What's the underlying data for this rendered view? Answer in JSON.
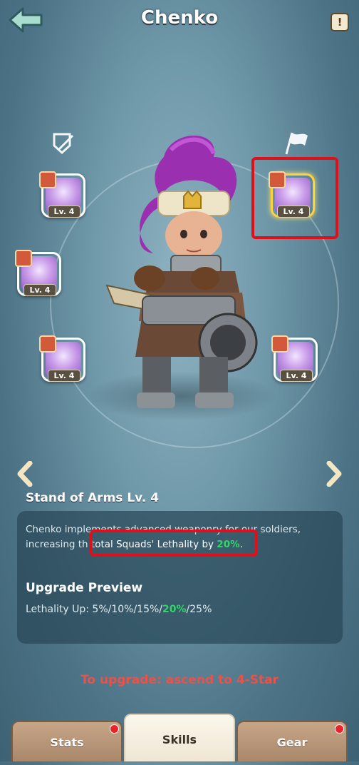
{
  "header": {
    "title": "Chenko",
    "info_label": "!"
  },
  "skills": [
    {
      "level": "Lv. 4"
    },
    {
      "level": "Lv. 4"
    },
    {
      "level": "Lv. 4"
    },
    {
      "level": "Lv. 4"
    },
    {
      "level": "Lv. 4"
    }
  ],
  "detail": {
    "skill_name": "Stand of Arms Lv. 4",
    "desc_part1": "Chenko implements advanced weaponry for our soldiers,",
    "desc_part2": "increasing th",
    "desc_hl": "total Squads' Lethality by ",
    "desc_value": "20%",
    "desc_end": ".",
    "upgrade_title": "Upgrade Preview",
    "upgrade_prefix": "Lethality Up: 5%/10%/15%/",
    "upgrade_current": "20%",
    "upgrade_suffix": "/25%",
    "requirement": "To upgrade: ascend to 4-Star"
  },
  "tabs": [
    {
      "label": "Stats",
      "badge": true
    },
    {
      "label": "Skills",
      "active": true
    },
    {
      "label": "Gear",
      "badge": true
    }
  ],
  "colors": {
    "highlight": "#e0101a",
    "value_green": "#35d36b",
    "requirement_red": "#e8524a"
  }
}
